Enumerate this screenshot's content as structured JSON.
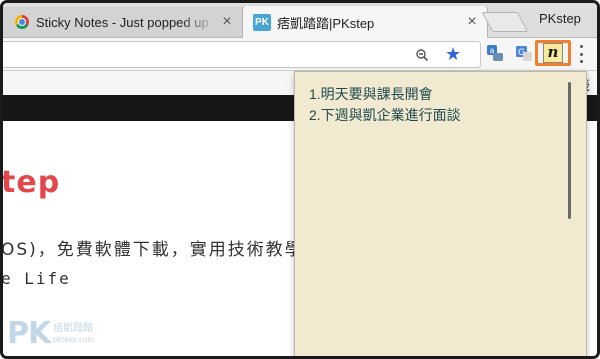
{
  "tabs": [
    {
      "title": "Sticky Notes - Just popped up",
      "active": false,
      "favicon": "chrome-icon"
    },
    {
      "title": "痞凱踏踏|PKstep",
      "active": true,
      "favicon": "pk-favicon-icon",
      "favicon_text": "PK"
    }
  ],
  "tab_close_glyph": "×",
  "profile_name": "PKstep",
  "toolbar": {
    "zoom_icon": "zoom-out-icon",
    "bookmark_icon": "star-icon",
    "extensions": [
      "translate-ext-icon",
      "google-translate-icon",
      "sticky-notes-icon"
    ],
    "notes_glyph": "n",
    "highlight_color": "#f07f2e"
  },
  "bookmarks_bar": {
    "item_label": "籤"
  },
  "page": {
    "heading": "tep",
    "desc_line1": "OS)，免費軟體下載，實用技術教學",
    "desc_line2": "e Life",
    "watermark_logo": "PK",
    "watermark_cn": "痞凱踏踏",
    "watermark_en": "pkstep.com"
  },
  "sticky_note": {
    "lines": [
      "1.明天要與課長開會",
      "2.下週與凱企業進行面談"
    ],
    "background": "#f1ead0",
    "text_color": "#1e4a4f"
  }
}
